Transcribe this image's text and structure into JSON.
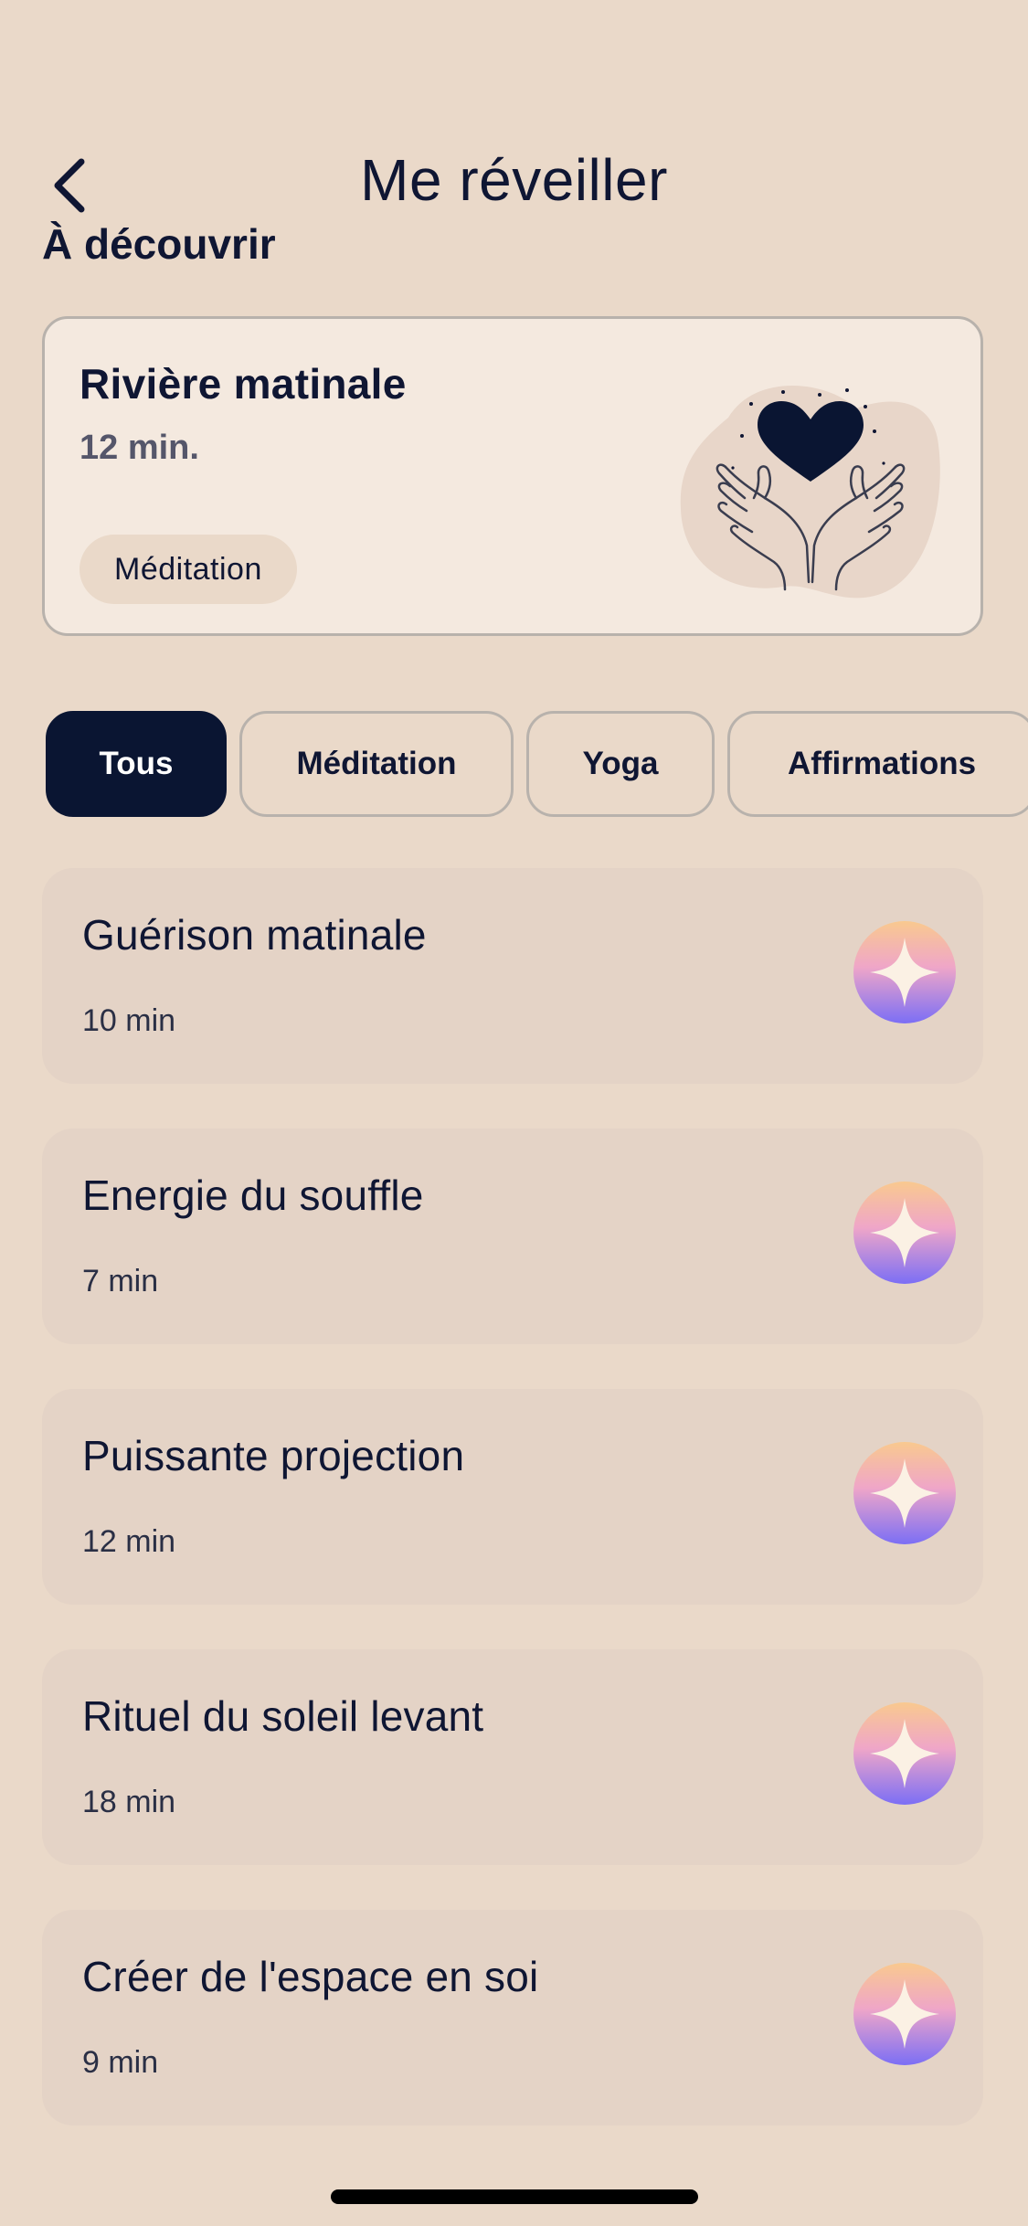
{
  "header": {
    "title": "Me réveiller",
    "back_icon": "chevron-left-icon"
  },
  "featured": {
    "section_title": "À découvrir",
    "title": "Rivière matinale",
    "duration": "12 min.",
    "tag": "Méditation",
    "illustration": "hands-holding-heart-illustration"
  },
  "filters": [
    {
      "label": "Tous",
      "active": true
    },
    {
      "label": "Méditation",
      "active": false
    },
    {
      "label": "Yoga",
      "active": false
    },
    {
      "label": "Affirmations",
      "active": false
    }
  ],
  "sessions": [
    {
      "title": "Guérison matinale",
      "duration": "10 min",
      "icon": "sparkle-icon"
    },
    {
      "title": "Energie du souffle",
      "duration": "7 min",
      "icon": "sparkle-icon"
    },
    {
      "title": "Puissante projection",
      "duration": "12 min",
      "icon": "sparkle-icon"
    },
    {
      "title": "Rituel du soleil levant",
      "duration": "18 min",
      "icon": "sparkle-icon"
    },
    {
      "title": "Créer de l'espace en soi",
      "duration": "9 min",
      "icon": "sparkle-icon"
    }
  ],
  "colors": {
    "background": "#ead9c9",
    "text": "#0f1633",
    "active_chip": "#0a1532",
    "card": "#e4d3c6"
  }
}
